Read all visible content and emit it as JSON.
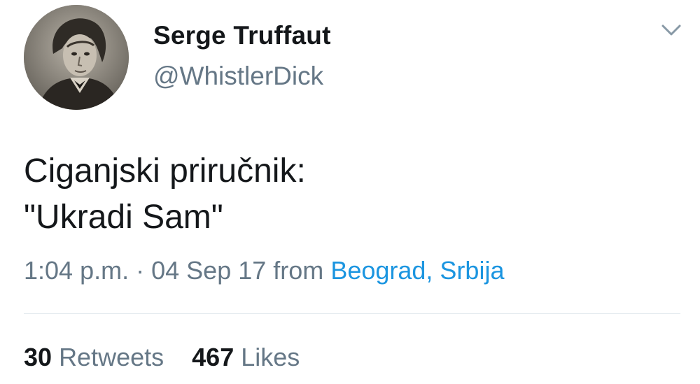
{
  "author": {
    "display_name": "Serge Truffaut",
    "handle": "@WhistlerDick",
    "avatar_icon": "portrait-avatar"
  },
  "menu": {
    "icon": "chevron-down-icon"
  },
  "tweet": {
    "lines": [
      "Ciganjski priručnik:",
      "\"Ukradi Sam\""
    ]
  },
  "meta": {
    "time": "1:04 p.m.",
    "separator": "·",
    "date": "04 Sep 17",
    "from_label": "from",
    "location": "Beograd, Srbija"
  },
  "stats": {
    "retweets_count": "30",
    "retweets_label": "Retweets",
    "likes_count": "467",
    "likes_label": "Likes"
  },
  "colors": {
    "text": "#14171a",
    "secondary": "#657786",
    "link": "#1b95e0",
    "divider": "#e1e8ed"
  }
}
